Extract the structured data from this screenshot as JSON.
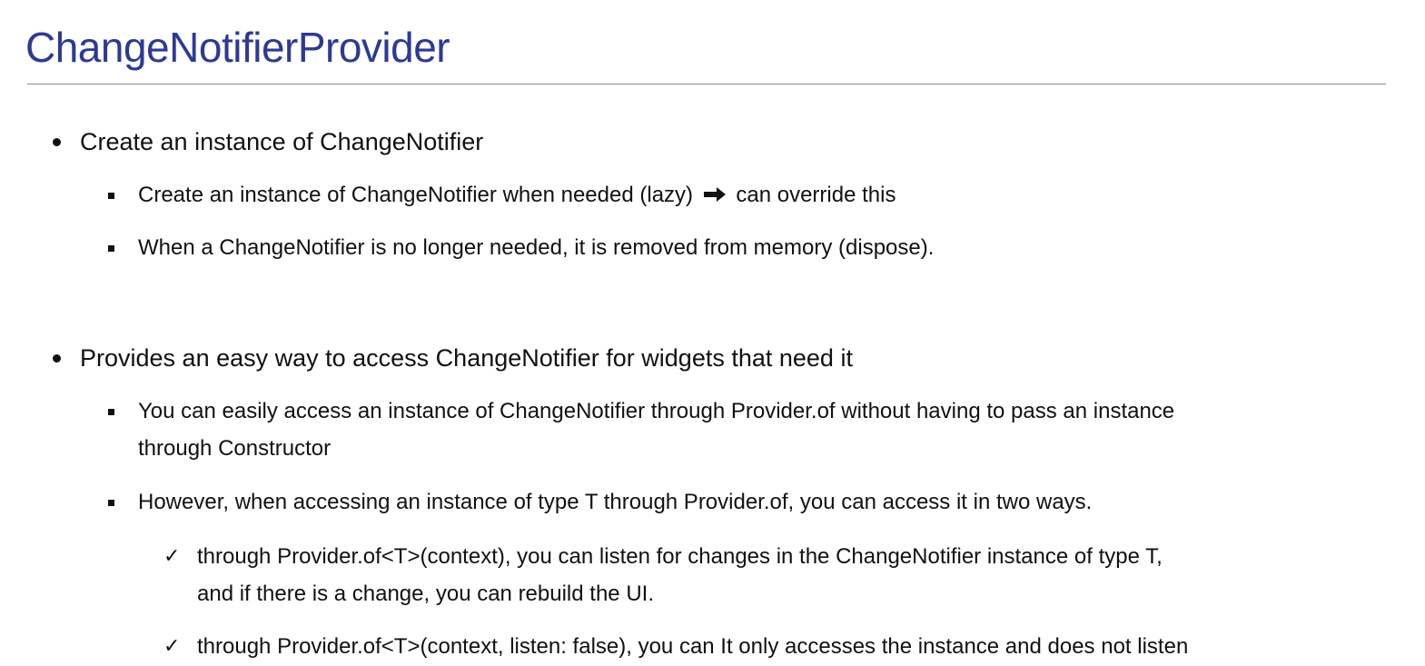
{
  "slide": {
    "title": "ChangeNotifierProvider",
    "sections": [
      {
        "heading": "Create an instance of ChangeNotifier",
        "items": [
          {
            "text_before_arrow": "Create an instance of ChangeNotifier when needed (lazy)",
            "arrow_icon": "right-arrow-icon",
            "text_after_arrow": "can override this"
          },
          {
            "text": "When a ChangeNotifier is no longer needed, it is removed from memory (dispose)."
          }
        ]
      },
      {
        "heading": "Provides an easy way to access ChangeNotifier for widgets that need it",
        "items": [
          {
            "lines": [
              "You can easily access an instance of ChangeNotifier through Provider.of without having to pass an instance",
              "through Constructor"
            ]
          },
          {
            "text": "However, when accessing an instance of type T through Provider.of, you can access it in two ways.",
            "subitems": [
              {
                "lines": [
                  "through Provider.of<T>(context), you can listen for changes in the ChangeNotifier instance of type T,",
                  "and if there is a change, you can rebuild the UI."
                ]
              },
              {
                "lines": [
                  "through Provider.of<T>(context, listen: false), you can It only accesses the instance and does not listen"
                ]
              }
            ]
          }
        ]
      }
    ],
    "check_glyph": "✓"
  }
}
